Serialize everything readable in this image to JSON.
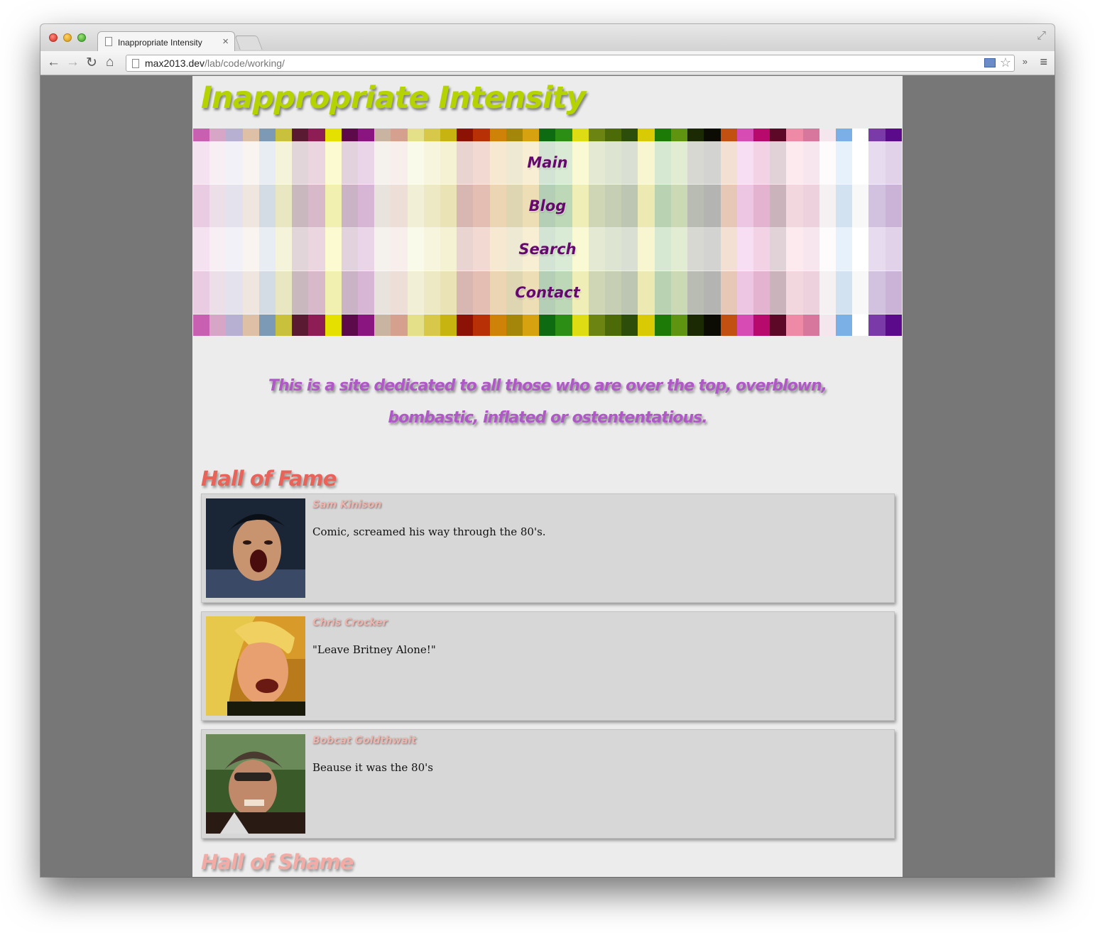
{
  "browser": {
    "tab_title": "Inappropriate Intensity",
    "tab_close": "×",
    "url_host": "max2013.dev",
    "url_path": "/lab/code/working/",
    "icons": [
      "back-icon",
      "forward-icon",
      "reload-icon",
      "home-icon",
      "star-icon",
      "menu-icon",
      "fullscreen-icon"
    ]
  },
  "site": {
    "title": "Inappropriate Intensity",
    "title_color": "#b5d300",
    "nav": [
      {
        "label": "Main"
      },
      {
        "label": "Blog"
      },
      {
        "label": "Search"
      },
      {
        "label": "Contact"
      }
    ],
    "tagline_line1": "This is a site dedicated to all those who are over the top, overblown,",
    "tagline_line2": "bombastic, inflated or ostententatious.",
    "hall_of_fame": {
      "heading": "Hall of Fame",
      "entries": [
        {
          "name": "Sam Kinison",
          "description": "Comic, screamed his way through the 80's."
        },
        {
          "name": "Chris Crocker",
          "description": "\"Leave Britney Alone!\""
        },
        {
          "name": "Bobcat Goldthwait",
          "description": "Beause it was the 80's"
        }
      ]
    },
    "hall_of_shame": {
      "heading": "Hall of Shame"
    },
    "colors": {
      "nav_text": "#66086e",
      "tagline": "#b158c8",
      "fame_heading": "#e8645a",
      "shame_heading": "#f2aca5",
      "page_bg": "#ececec",
      "viewport_bg": "#777777"
    }
  }
}
